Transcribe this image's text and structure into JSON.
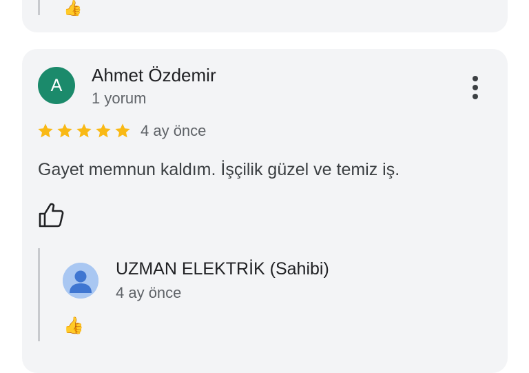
{
  "previous_review": {
    "reply_reaction": "👍"
  },
  "review": {
    "avatar_initial": "A",
    "avatar_color": "#1b8a6b",
    "reviewer_name": "Ahmet Özdemir",
    "review_count": "1 yorum",
    "rating": 5,
    "rating_max": 5,
    "star_color": "#f9b915",
    "date": "4 ay önce",
    "text": "Gayet memnun kaldım. İşçilik güzel ve temiz iş.",
    "more_icon": "more-vert-icon",
    "like_icon": "thumbs-up-outline-icon"
  },
  "owner_reply": {
    "name": "UZMAN ELEKTRİK (Sahibi)",
    "date": "4 ay önce",
    "avatar_icon": "person-icon",
    "avatar_color": "#a9c7f2",
    "reaction": "👍"
  }
}
